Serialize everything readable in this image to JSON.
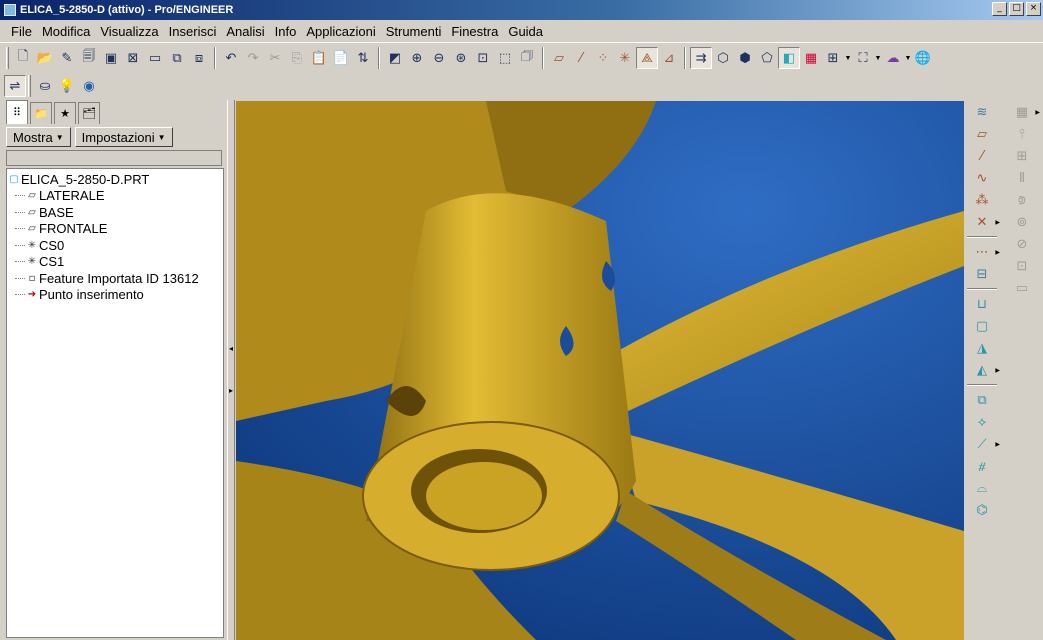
{
  "window": {
    "title": "ELICA_5-2850-D (attivo) - Pro/ENGINEER",
    "controls": [
      "minimize",
      "maximize",
      "close"
    ]
  },
  "menu": [
    "File",
    "Modifica",
    "Visualizza",
    "Inserisci",
    "Analisi",
    "Info",
    "Applicazioni",
    "Strumenti",
    "Finestra",
    "Guida"
  ],
  "toolbar_icons": {
    "file_group": [
      "new-icon",
      "open-icon",
      "save-icon",
      "save-copy-icon",
      "window-icon",
      "close-window-icon",
      "erase-icon",
      "backup-icon",
      "export-icon"
    ],
    "edit_group": [
      "undo-icon",
      "redo-icon",
      "cut-icon",
      "copy-icon",
      "paste-icon",
      "paste-special-icon",
      "regenerate-icon"
    ],
    "view_group": [
      "repaint-icon",
      "zoom-in-icon",
      "zoom-out-icon",
      "refit-icon",
      "orient-icon",
      "saved-views-icon",
      "layers-icon"
    ],
    "datum_group": [
      "datum-plane-icon",
      "datum-axis-icon",
      "datum-point-icon",
      "csys-icon",
      "spin-center-icon",
      "annotation-icon"
    ],
    "display_group": [
      "model-tree-icon",
      "wireframe-icon",
      "hidden-line-icon",
      "no-hidden-icon",
      "shading-icon",
      "color-icon",
      "measure-icon",
      "relations-icon",
      "appearance-icon",
      "web-browser-icon"
    ]
  },
  "left_panel": {
    "tabs": [
      "model-tree-tab",
      "layer-tab",
      "favorites-tab",
      "folder-tab"
    ],
    "show_label": "Mostra",
    "settings_label": "Impostazioni",
    "tree": {
      "root": "ELICA_5-2850-D.PRT",
      "items": [
        {
          "label": "LATERALE",
          "icon": "datum-plane-icon"
        },
        {
          "label": "BASE",
          "icon": "datum-plane-icon"
        },
        {
          "label": "FRONTALE",
          "icon": "datum-plane-icon"
        },
        {
          "label": "CS0",
          "icon": "csys-icon"
        },
        {
          "label": "CS1",
          "icon": "csys-icon"
        },
        {
          "label": "Feature Importata ID 13612",
          "icon": "imported-feature-icon"
        },
        {
          "label": "Punto inserimento",
          "icon": "insert-here-icon"
        }
      ]
    }
  },
  "viewport": {
    "model": "propeller",
    "background_color": "#1f56a8",
    "model_color": "#d4a82a"
  }
}
